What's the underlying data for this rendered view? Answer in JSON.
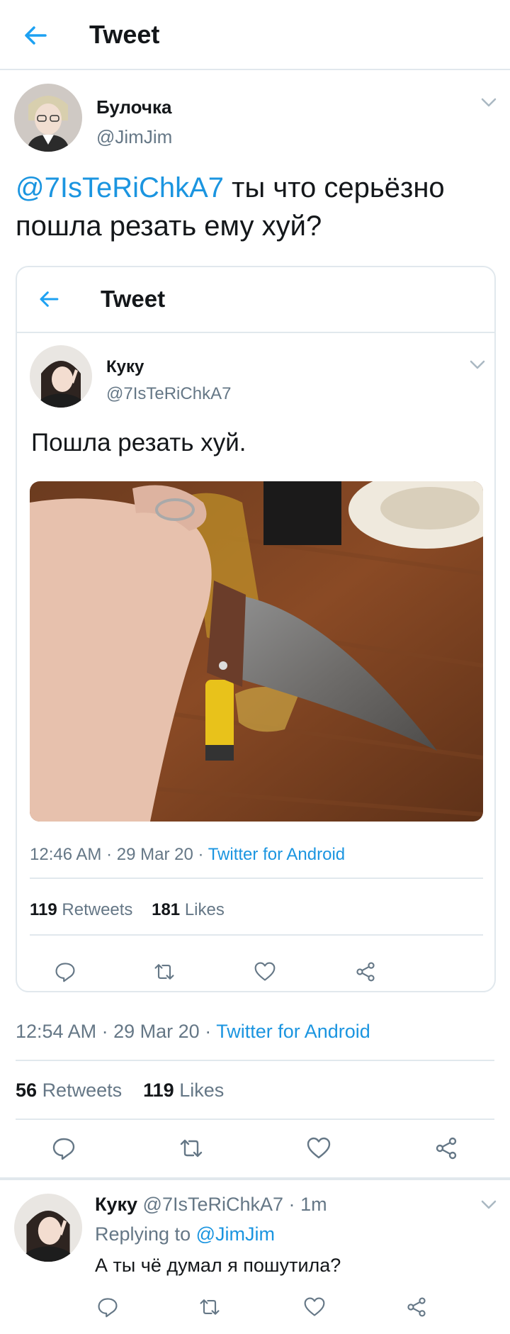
{
  "header": {
    "title": "Tweet"
  },
  "main_tweet": {
    "author_name": "Булочка",
    "author_handle": "@JimJim",
    "mention": "@7IsTeRiChkA7",
    "text": " ты что серьёзно пошла резать ему хуй?",
    "time": "12:54 AM",
    "date": "29 Mar 20",
    "source": "Twitter for Android",
    "retweets_count": "56",
    "retweets_label": "Retweets",
    "likes_count": "119",
    "likes_label": "Likes"
  },
  "quoted_tweet": {
    "header_title": "Tweet",
    "author_name": "Куку",
    "author_handle": "@7IsTeRiChkA7",
    "text": "Пошла резать хуй.",
    "time": "12:46 AM",
    "date": "29 Mar 20",
    "source": "Twitter for Android",
    "retweets_count": "119",
    "retweets_label": "Retweets",
    "likes_count": "181",
    "likes_label": "Likes"
  },
  "reply": {
    "author_name": "Куку",
    "author_handle": "@7IsTeRiChkA7",
    "time_ago": "1m",
    "replying_prefix": "Replying to",
    "replying_to": "@JimJim",
    "text": "А ты чё думал я пошутила?"
  },
  "separators": {
    "dot": "·"
  },
  "icons": [
    "back-arrow-icon",
    "chevron-down-icon",
    "reply-icon",
    "retweet-icon",
    "like-icon",
    "share-icon"
  ],
  "colors": {
    "accent": "#1b95e0",
    "text": "#14171a",
    "muted": "#657786",
    "divider": "#e1e8ed"
  }
}
